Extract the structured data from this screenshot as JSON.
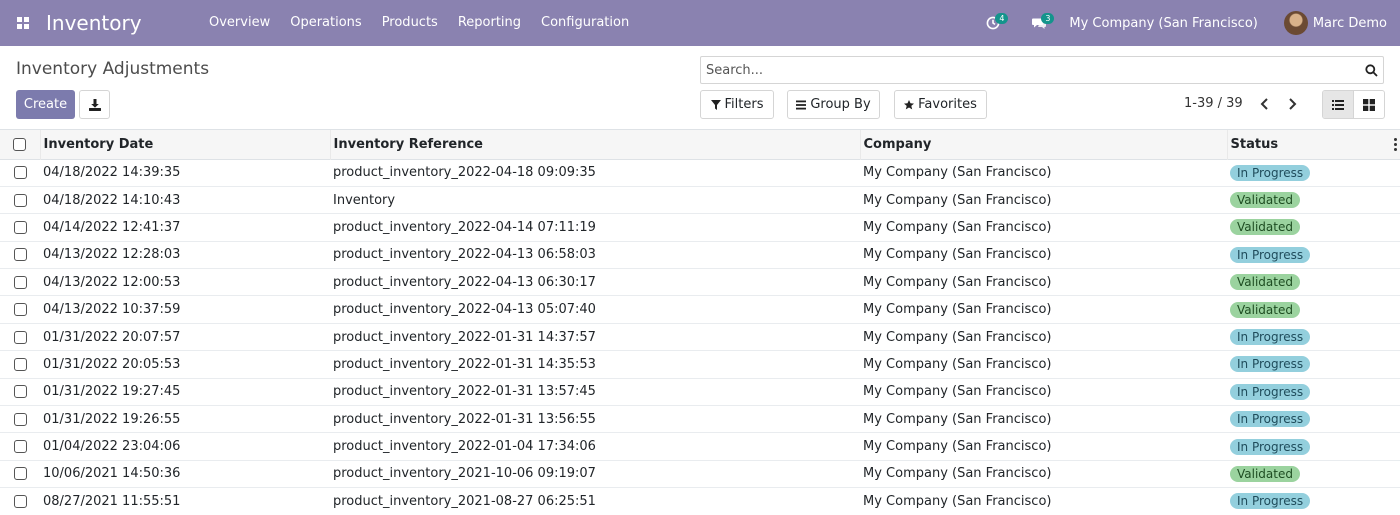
{
  "navbar": {
    "app_name": "Inventory",
    "menu": [
      "Overview",
      "Operations",
      "Products",
      "Reporting",
      "Configuration"
    ],
    "activity_count": "4",
    "message_count": "3",
    "company": "My Company (San Francisco)",
    "user": "Marc Demo",
    "bg_color": "#8a82b0",
    "badge_color": "#14948c"
  },
  "control_panel": {
    "title": "Inventory Adjustments",
    "create_label": "Create",
    "search_placeholder": "Search...",
    "filters_label": "Filters",
    "groupby_label": "Group By",
    "favorites_label": "Favorites",
    "pager": "1-39 / 39",
    "accent_color": "#7c7bad"
  },
  "table": {
    "columns": [
      "Inventory Date",
      "Inventory Reference",
      "Company",
      "Status"
    ],
    "rows": [
      {
        "date": "04/18/2022 14:39:35",
        "ref": "product_inventory_2022-04-18 09:09:35",
        "company": "My Company (San Francisco)",
        "status": "In Progress",
        "state": "progress"
      },
      {
        "date": "04/18/2022 14:10:43",
        "ref": "Inventory",
        "company": "My Company (San Francisco)",
        "status": "Validated",
        "state": "validated"
      },
      {
        "date": "04/14/2022 12:41:37",
        "ref": "product_inventory_2022-04-14 07:11:19",
        "company": "My Company (San Francisco)",
        "status": "Validated",
        "state": "validated"
      },
      {
        "date": "04/13/2022 12:28:03",
        "ref": "product_inventory_2022-04-13 06:58:03",
        "company": "My Company (San Francisco)",
        "status": "In Progress",
        "state": "progress"
      },
      {
        "date": "04/13/2022 12:00:53",
        "ref": "product_inventory_2022-04-13 06:30:17",
        "company": "My Company (San Francisco)",
        "status": "Validated",
        "state": "validated"
      },
      {
        "date": "04/13/2022 10:37:59",
        "ref": "product_inventory_2022-04-13 05:07:40",
        "company": "My Company (San Francisco)",
        "status": "Validated",
        "state": "validated"
      },
      {
        "date": "01/31/2022 20:07:57",
        "ref": "product_inventory_2022-01-31 14:37:57",
        "company": "My Company (San Francisco)",
        "status": "In Progress",
        "state": "progress"
      },
      {
        "date": "01/31/2022 20:05:53",
        "ref": "product_inventory_2022-01-31 14:35:53",
        "company": "My Company (San Francisco)",
        "status": "In Progress",
        "state": "progress"
      },
      {
        "date": "01/31/2022 19:27:45",
        "ref": "product_inventory_2022-01-31 13:57:45",
        "company": "My Company (San Francisco)",
        "status": "In Progress",
        "state": "progress"
      },
      {
        "date": "01/31/2022 19:26:55",
        "ref": "product_inventory_2022-01-31 13:56:55",
        "company": "My Company (San Francisco)",
        "status": "In Progress",
        "state": "progress"
      },
      {
        "date": "01/04/2022 23:04:06",
        "ref": "product_inventory_2022-01-04 17:34:06",
        "company": "My Company (San Francisco)",
        "status": "In Progress",
        "state": "progress"
      },
      {
        "date": "10/06/2021 14:50:36",
        "ref": "product_inventory_2021-10-06 09:19:07",
        "company": "My Company (San Francisco)",
        "status": "Validated",
        "state": "validated"
      },
      {
        "date": "08/27/2021 11:55:51",
        "ref": "product_inventory_2021-08-27 06:25:51",
        "company": "My Company (San Francisco)",
        "status": "In Progress",
        "state": "progress"
      }
    ]
  },
  "colors": {
    "in_progress": "#93cfdd",
    "validated": "#9bd39f"
  },
  "icons": {
    "apps": "apps-grid-icon",
    "activity": "clock-icon",
    "messages": "chat-icon",
    "download": "download-icon",
    "search": "search-icon",
    "filter": "filter-icon",
    "groupby": "list-icon",
    "favorites": "star-icon",
    "prev": "chevron-left-icon",
    "next": "chevron-right-icon",
    "list_view": "list-view-icon",
    "kanban_view": "kanban-view-icon",
    "optional_columns": "vertical-dots-icon"
  }
}
